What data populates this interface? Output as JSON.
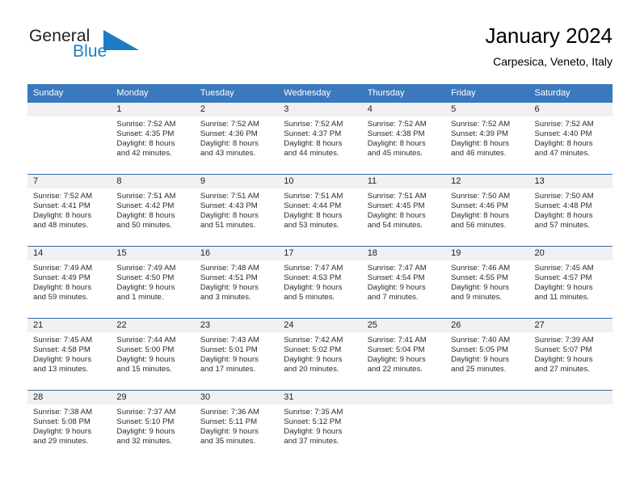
{
  "brand": {
    "name_top": "General",
    "name_bottom": "Blue",
    "triangle_color": "#1c7dc4",
    "top_color": "#231f20",
    "bottom_color": "#1c7dc4"
  },
  "header": {
    "title": "January 2024",
    "subtitle": "Carpesica, Veneto, Italy"
  },
  "colors": {
    "header_band": "#3a79bd",
    "week_divider": "#2e6ca8",
    "daynum_strip": "#f0f0f0",
    "text": "#000000"
  },
  "weekday_headers": [
    "Sunday",
    "Monday",
    "Tuesday",
    "Wednesday",
    "Thursday",
    "Friday",
    "Saturday"
  ],
  "weeks": [
    [
      {
        "day": "",
        "sunrise": "",
        "sunset": "",
        "daylight_line1": "",
        "daylight_line2": ""
      },
      {
        "day": "1",
        "sunrise": "Sunrise: 7:52 AM",
        "sunset": "Sunset: 4:35 PM",
        "daylight_line1": "Daylight: 8 hours",
        "daylight_line2": "and 42 minutes."
      },
      {
        "day": "2",
        "sunrise": "Sunrise: 7:52 AM",
        "sunset": "Sunset: 4:36 PM",
        "daylight_line1": "Daylight: 8 hours",
        "daylight_line2": "and 43 minutes."
      },
      {
        "day": "3",
        "sunrise": "Sunrise: 7:52 AM",
        "sunset": "Sunset: 4:37 PM",
        "daylight_line1": "Daylight: 8 hours",
        "daylight_line2": "and 44 minutes."
      },
      {
        "day": "4",
        "sunrise": "Sunrise: 7:52 AM",
        "sunset": "Sunset: 4:38 PM",
        "daylight_line1": "Daylight: 8 hours",
        "daylight_line2": "and 45 minutes."
      },
      {
        "day": "5",
        "sunrise": "Sunrise: 7:52 AM",
        "sunset": "Sunset: 4:39 PM",
        "daylight_line1": "Daylight: 8 hours",
        "daylight_line2": "and 46 minutes."
      },
      {
        "day": "6",
        "sunrise": "Sunrise: 7:52 AM",
        "sunset": "Sunset: 4:40 PM",
        "daylight_line1": "Daylight: 8 hours",
        "daylight_line2": "and 47 minutes."
      }
    ],
    [
      {
        "day": "7",
        "sunrise": "Sunrise: 7:52 AM",
        "sunset": "Sunset: 4:41 PM",
        "daylight_line1": "Daylight: 8 hours",
        "daylight_line2": "and 48 minutes."
      },
      {
        "day": "8",
        "sunrise": "Sunrise: 7:51 AM",
        "sunset": "Sunset: 4:42 PM",
        "daylight_line1": "Daylight: 8 hours",
        "daylight_line2": "and 50 minutes."
      },
      {
        "day": "9",
        "sunrise": "Sunrise: 7:51 AM",
        "sunset": "Sunset: 4:43 PM",
        "daylight_line1": "Daylight: 8 hours",
        "daylight_line2": "and 51 minutes."
      },
      {
        "day": "10",
        "sunrise": "Sunrise: 7:51 AM",
        "sunset": "Sunset: 4:44 PM",
        "daylight_line1": "Daylight: 8 hours",
        "daylight_line2": "and 53 minutes."
      },
      {
        "day": "11",
        "sunrise": "Sunrise: 7:51 AM",
        "sunset": "Sunset: 4:45 PM",
        "daylight_line1": "Daylight: 8 hours",
        "daylight_line2": "and 54 minutes."
      },
      {
        "day": "12",
        "sunrise": "Sunrise: 7:50 AM",
        "sunset": "Sunset: 4:46 PM",
        "daylight_line1": "Daylight: 8 hours",
        "daylight_line2": "and 56 minutes."
      },
      {
        "day": "13",
        "sunrise": "Sunrise: 7:50 AM",
        "sunset": "Sunset: 4:48 PM",
        "daylight_line1": "Daylight: 8 hours",
        "daylight_line2": "and 57 minutes."
      }
    ],
    [
      {
        "day": "14",
        "sunrise": "Sunrise: 7:49 AM",
        "sunset": "Sunset: 4:49 PM",
        "daylight_line1": "Daylight: 8 hours",
        "daylight_line2": "and 59 minutes."
      },
      {
        "day": "15",
        "sunrise": "Sunrise: 7:49 AM",
        "sunset": "Sunset: 4:50 PM",
        "daylight_line1": "Daylight: 9 hours",
        "daylight_line2": "and 1 minute."
      },
      {
        "day": "16",
        "sunrise": "Sunrise: 7:48 AM",
        "sunset": "Sunset: 4:51 PM",
        "daylight_line1": "Daylight: 9 hours",
        "daylight_line2": "and 3 minutes."
      },
      {
        "day": "17",
        "sunrise": "Sunrise: 7:47 AM",
        "sunset": "Sunset: 4:53 PM",
        "daylight_line1": "Daylight: 9 hours",
        "daylight_line2": "and 5 minutes."
      },
      {
        "day": "18",
        "sunrise": "Sunrise: 7:47 AM",
        "sunset": "Sunset: 4:54 PM",
        "daylight_line1": "Daylight: 9 hours",
        "daylight_line2": "and 7 minutes."
      },
      {
        "day": "19",
        "sunrise": "Sunrise: 7:46 AM",
        "sunset": "Sunset: 4:55 PM",
        "daylight_line1": "Daylight: 9 hours",
        "daylight_line2": "and 9 minutes."
      },
      {
        "day": "20",
        "sunrise": "Sunrise: 7:45 AM",
        "sunset": "Sunset: 4:57 PM",
        "daylight_line1": "Daylight: 9 hours",
        "daylight_line2": "and 11 minutes."
      }
    ],
    [
      {
        "day": "21",
        "sunrise": "Sunrise: 7:45 AM",
        "sunset": "Sunset: 4:58 PM",
        "daylight_line1": "Daylight: 9 hours",
        "daylight_line2": "and 13 minutes."
      },
      {
        "day": "22",
        "sunrise": "Sunrise: 7:44 AM",
        "sunset": "Sunset: 5:00 PM",
        "daylight_line1": "Daylight: 9 hours",
        "daylight_line2": "and 15 minutes."
      },
      {
        "day": "23",
        "sunrise": "Sunrise: 7:43 AM",
        "sunset": "Sunset: 5:01 PM",
        "daylight_line1": "Daylight: 9 hours",
        "daylight_line2": "and 17 minutes."
      },
      {
        "day": "24",
        "sunrise": "Sunrise: 7:42 AM",
        "sunset": "Sunset: 5:02 PM",
        "daylight_line1": "Daylight: 9 hours",
        "daylight_line2": "and 20 minutes."
      },
      {
        "day": "25",
        "sunrise": "Sunrise: 7:41 AM",
        "sunset": "Sunset: 5:04 PM",
        "daylight_line1": "Daylight: 9 hours",
        "daylight_line2": "and 22 minutes."
      },
      {
        "day": "26",
        "sunrise": "Sunrise: 7:40 AM",
        "sunset": "Sunset: 5:05 PM",
        "daylight_line1": "Daylight: 9 hours",
        "daylight_line2": "and 25 minutes."
      },
      {
        "day": "27",
        "sunrise": "Sunrise: 7:39 AM",
        "sunset": "Sunset: 5:07 PM",
        "daylight_line1": "Daylight: 9 hours",
        "daylight_line2": "and 27 minutes."
      }
    ],
    [
      {
        "day": "28",
        "sunrise": "Sunrise: 7:38 AM",
        "sunset": "Sunset: 5:08 PM",
        "daylight_line1": "Daylight: 9 hours",
        "daylight_line2": "and 29 minutes."
      },
      {
        "day": "29",
        "sunrise": "Sunrise: 7:37 AM",
        "sunset": "Sunset: 5:10 PM",
        "daylight_line1": "Daylight: 9 hours",
        "daylight_line2": "and 32 minutes."
      },
      {
        "day": "30",
        "sunrise": "Sunrise: 7:36 AM",
        "sunset": "Sunset: 5:11 PM",
        "daylight_line1": "Daylight: 9 hours",
        "daylight_line2": "and 35 minutes."
      },
      {
        "day": "31",
        "sunrise": "Sunrise: 7:35 AM",
        "sunset": "Sunset: 5:12 PM",
        "daylight_line1": "Daylight: 9 hours",
        "daylight_line2": "and 37 minutes."
      },
      {
        "day": "",
        "sunrise": "",
        "sunset": "",
        "daylight_line1": "",
        "daylight_line2": ""
      },
      {
        "day": "",
        "sunrise": "",
        "sunset": "",
        "daylight_line1": "",
        "daylight_line2": ""
      },
      {
        "day": "",
        "sunrise": "",
        "sunset": "",
        "daylight_line1": "",
        "daylight_line2": ""
      }
    ]
  ]
}
